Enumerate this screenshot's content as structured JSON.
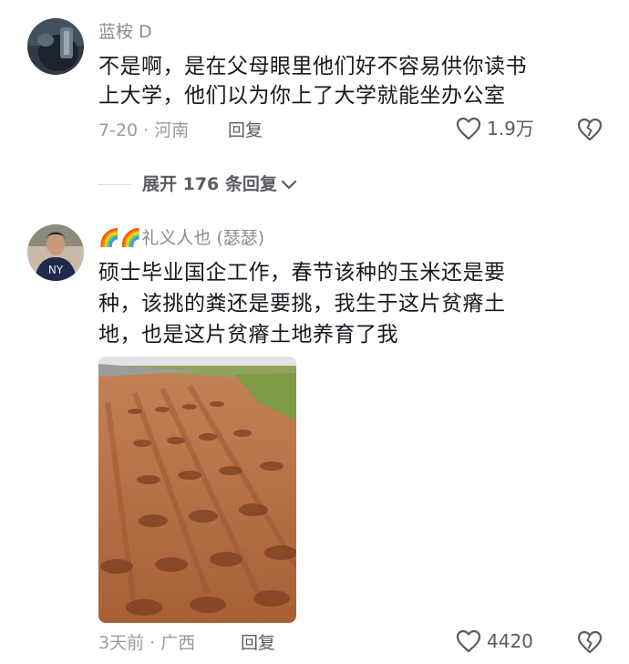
{
  "comment1": {
    "username": "蓝桉 D",
    "lines": [
      "不是啊，是在父母眼里他们好不容易供你读书",
      "上大学，他们以为你上了大学就能坐办公室"
    ],
    "meta": "7-20 · 河南",
    "reply_label": "回复",
    "likes": "1.9万"
  },
  "expand": {
    "label": "展开 176 条回复"
  },
  "comment2": {
    "emoji": "🌈🌈",
    "username": "礼义人也 (瑟瑟)",
    "lines": [
      "硕士毕业国企工作，春节该种的玉米还是要",
      "种，该挑的粪还是要挑，我生于这片贫瘠土",
      "地，也是这片贫瘠土地养育了我"
    ],
    "meta": "3天前 · 广西",
    "reply_label": "回复",
    "likes": "4420"
  },
  "colors": {
    "text": "#161823",
    "secondary": "#8a8b91",
    "soil": "#b5714a"
  },
  "icons": [
    "heart-outline-icon",
    "dislike-heart-icon",
    "chevron-down-icon"
  ]
}
